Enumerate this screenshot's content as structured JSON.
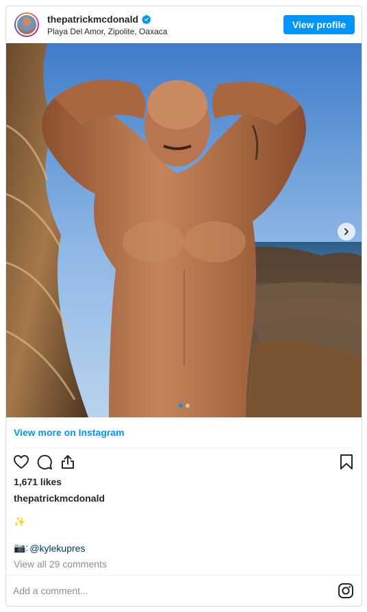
{
  "header": {
    "username": "thepatrickmcdonald",
    "location": "Playa Del Amor, Zipolite, Oaxaca",
    "view_profile_label": "View profile",
    "avatar_icon": "profile-avatar",
    "verified_icon": "verified-badge-icon"
  },
  "photo": {
    "carousel_index": 1,
    "carousel_count": 2,
    "next_icon": "chevron-right-icon"
  },
  "view_more_label": "View more on Instagram",
  "actions": {
    "icons": [
      "heart-icon",
      "comment-icon",
      "share-icon",
      "bookmark-icon"
    ]
  },
  "likes_text": "1,671 likes",
  "caption": {
    "username": "thepatrickmcdonald",
    "line1": "✨",
    "credit_prefix": "📷: ",
    "credit_mention": "@kylekupres"
  },
  "comments_link": "View all 29 comments",
  "comment_box": {
    "placeholder": "Add a comment...",
    "icon": "instagram-glyph-icon"
  },
  "colors": {
    "accent_blue": "#0095f6",
    "mention_blue": "#00376b",
    "muted_gray": "#8e8e8e"
  }
}
